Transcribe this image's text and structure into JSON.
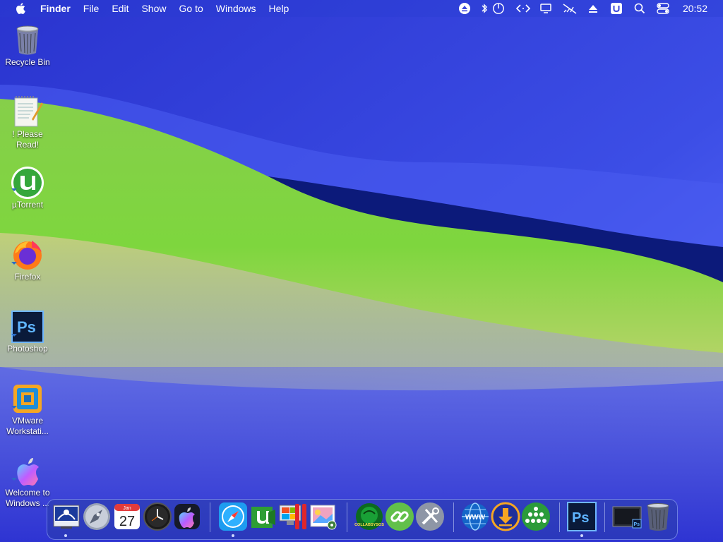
{
  "menubar": {
    "app_name": "Finder",
    "menus": [
      "File",
      "Edit",
      "Show",
      "Go to",
      "Windows",
      "Help"
    ],
    "status_icons": [
      "eject-icon",
      "bluetooth-icon",
      "power-icon",
      "code-brackets-icon",
      "display-icon",
      "network-off-icon",
      "upload-icon",
      "utorrent-tray-icon",
      "spotlight-search-icon",
      "control-center-icon"
    ],
    "clock": "20:52"
  },
  "desktop": {
    "icons": [
      {
        "label": "Recycle Bin",
        "icon": "recycle-bin-icon"
      },
      {
        "label": "! Please Read!",
        "icon": "notepad-icon"
      },
      {
        "label": "µTorrent",
        "icon": "utorrent-icon"
      },
      {
        "label": "Firefox",
        "icon": "firefox-icon"
      },
      {
        "label": "Photoshop",
        "icon": "photoshop-icon"
      },
      {
        "label": "VMware Workstati...",
        "icon": "vmware-icon"
      },
      {
        "label": "Welcome to Windows ...",
        "icon": "apple-welcome-icon"
      }
    ]
  },
  "dock": {
    "items": [
      {
        "name": "finder",
        "icon": "finder-icon"
      },
      {
        "name": "launchpad",
        "icon": "rocket-icon"
      },
      {
        "name": "calendar",
        "icon": "calendar-icon",
        "month": "Jan",
        "day": "27"
      },
      {
        "name": "clock",
        "icon": "clock-icon"
      },
      {
        "name": "apple",
        "icon": "apple-logo-icon"
      },
      {
        "name": "safari",
        "icon": "safari-compass-icon"
      },
      {
        "name": "utorrent",
        "icon": "utorrent-dock-icon"
      },
      {
        "name": "bootcamp",
        "icon": "bootcamp-icon"
      },
      {
        "name": "parallels",
        "icon": "parallels-icon"
      },
      {
        "name": "photos",
        "icon": "photo-viewer-icon"
      },
      {
        "name": "collabsysos",
        "icon": "collabsysos-icon",
        "text": "COLLABSYSOS"
      },
      {
        "name": "links",
        "icon": "chain-link-icon"
      },
      {
        "name": "tools",
        "icon": "tools-icon"
      },
      {
        "name": "www",
        "icon": "www-globe-icon",
        "text": "WWW"
      },
      {
        "name": "download",
        "icon": "download-arrow-icon"
      },
      {
        "name": "network",
        "icon": "people-network-icon"
      },
      {
        "name": "photoshop",
        "icon": "photoshop-dock-icon",
        "text": "Ps"
      },
      {
        "name": "screen",
        "icon": "screen-ps-icon",
        "text": "Ps"
      },
      {
        "name": "trash",
        "icon": "trash-icon"
      }
    ]
  },
  "colors": {
    "sky": "#3a46dc",
    "hill_green": "#7cd044",
    "dark_wave": "#0c1a7a",
    "accent_blue": "#2b8fff"
  }
}
